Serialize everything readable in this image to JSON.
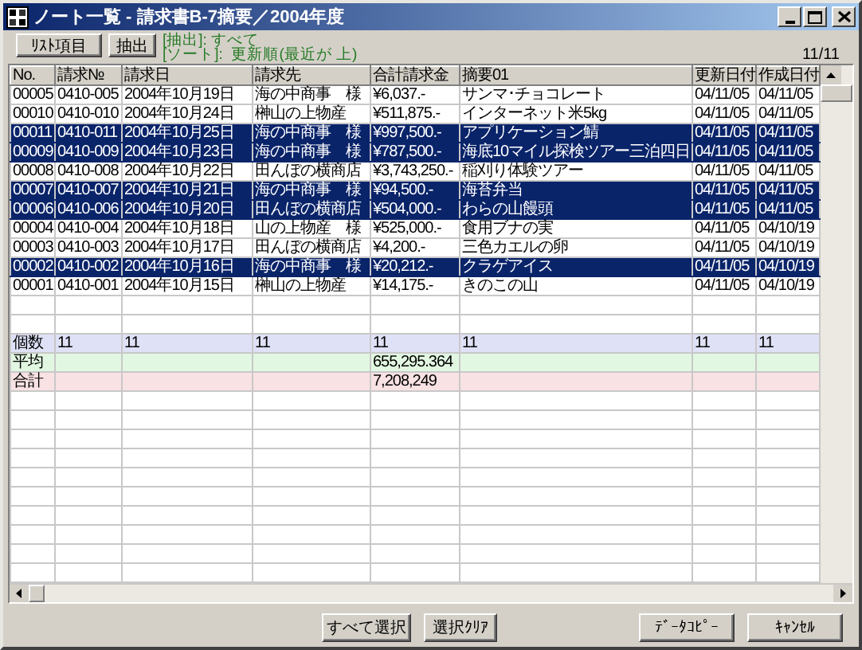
{
  "window": {
    "title": "ノート一覧 - 請求書B-7摘要／2004年度"
  },
  "toolbar": {
    "buttons": [
      "ﾘｽﾄ項目",
      "抽出"
    ],
    "filter": "[抽出]: すべて",
    "sort": "[ソート]:  更新順(最近が 上)",
    "count": "11/11"
  },
  "table": {
    "columns": [
      "No.",
      "請求№",
      "請求日",
      "請求先",
      "合計請求金",
      "摘要01",
      "更新日付",
      "作成日付"
    ],
    "rows": [
      {
        "selected": false,
        "cells": [
          "00005",
          "0410-005",
          "2004年10月19日",
          "海の中商事　様",
          "¥6,037.-",
          "サンマ･チョコレート",
          "04/11/05",
          "04/11/05"
        ]
      },
      {
        "selected": false,
        "cells": [
          "00010",
          "0410-010",
          "2004年10月24日",
          "榊山の上物産",
          "¥511,875.-",
          "インターネット米5kg",
          "04/11/05",
          "04/11/05"
        ]
      },
      {
        "selected": true,
        "cells": [
          "00011",
          "0410-011",
          "2004年10月25日",
          "海の中商事　様",
          "¥997,500.-",
          "アプリケーション鯖",
          "04/11/05",
          "04/11/05"
        ]
      },
      {
        "selected": true,
        "cells": [
          "00009",
          "0410-009",
          "2004年10月23日",
          "海の中商事　様",
          "¥787,500.-",
          "海底10マイル探検ツアー三泊四日",
          "04/11/05",
          "04/11/05"
        ]
      },
      {
        "selected": false,
        "cells": [
          "00008",
          "0410-008",
          "2004年10月22日",
          "田んぼの横商店",
          "¥3,743,250.-",
          "稲刈り体験ツアー",
          "04/11/05",
          "04/11/05"
        ]
      },
      {
        "selected": true,
        "cells": [
          "00007",
          "0410-007",
          "2004年10月21日",
          "海の中商事　様",
          "¥94,500.-",
          "海苔弁当",
          "04/11/05",
          "04/11/05"
        ]
      },
      {
        "selected": true,
        "cells": [
          "00006",
          "0410-006",
          "2004年10月20日",
          "田んぼの横商店",
          "¥504,000.-",
          "わらの山饅頭",
          "04/11/05",
          "04/11/05"
        ]
      },
      {
        "selected": false,
        "cells": [
          "00004",
          "0410-004",
          "2004年10月18日",
          "山の上物産　様",
          "¥525,000.-",
          "食用ブナの実",
          "04/11/05",
          "04/10/19"
        ]
      },
      {
        "selected": false,
        "cells": [
          "00003",
          "0410-003",
          "2004年10月17日",
          "田んぼの横商店",
          "¥4,200.-",
          "三色カエルの卵",
          "04/11/05",
          "04/10/19"
        ]
      },
      {
        "selected": true,
        "cells": [
          "00002",
          "0410-002",
          "2004年10月16日",
          "海の中商事　様",
          "¥20,212.-",
          "クラゲアイス",
          "04/11/05",
          "04/10/19"
        ]
      },
      {
        "selected": false,
        "cells": [
          "00001",
          "0410-001",
          "2004年10月15日",
          "榊山の上物産",
          "¥14,175.-",
          "きのこの山",
          "04/11/05",
          "04/10/19"
        ]
      }
    ],
    "summary_rows": [
      {
        "label": "個数",
        "color": "#dfe1f7",
        "cells": [
          "11",
          "11",
          "11",
          "11",
          "11",
          "11",
          "11"
        ]
      },
      {
        "label": "平均",
        "color": "#e2f7e2",
        "amount": "655,295.364"
      },
      {
        "label": "合計",
        "color": "#f9e2e4",
        "amount": "7,208,249"
      }
    ]
  },
  "buttons": [
    "すべて選択",
    "選択ｸﾘｱ",
    "ﾃﾞｰﾀｺﾋﾟｰ",
    "ｷｬﾝｾﾙ"
  ]
}
